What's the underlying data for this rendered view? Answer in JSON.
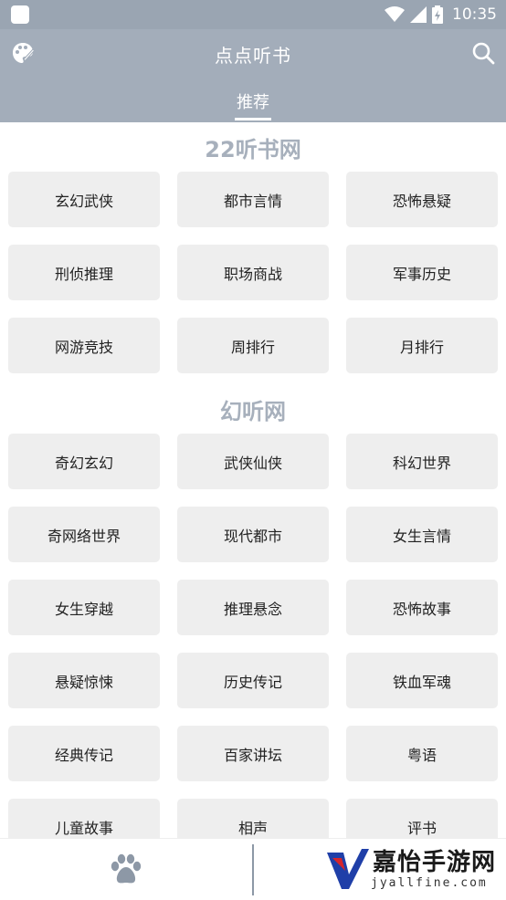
{
  "status_bar": {
    "time": "10:35"
  },
  "app_bar": {
    "title": "点点听书",
    "tabs": [
      {
        "label": "推荐",
        "active": true
      }
    ]
  },
  "sections": [
    {
      "title": "22听书网",
      "items": [
        "玄幻武侠",
        "都市言情",
        "恐怖悬疑",
        "刑侦推理",
        "职场商战",
        "军事历史",
        "网游竞技",
        "周排行",
        "月排行"
      ]
    },
    {
      "title": "幻听网",
      "items": [
        "奇幻玄幻",
        "武侠仙侠",
        "科幻世界",
        "奇网络世界",
        "现代都市",
        "女生言情",
        "女生穿越",
        "推理悬念",
        "恐怖故事",
        "悬疑惊悚",
        "历史传记",
        "铁血军魂",
        "经典传记",
        "百家讲坛",
        "粤语",
        "儿童故事",
        "相声",
        "评书"
      ]
    }
  ],
  "watermark": {
    "text": "嘉怡手游网",
    "sub": "jyallfine.com"
  },
  "colors": {
    "app_bar": "#a3adba",
    "status_bar": "#9aa5b2",
    "section_title": "#a7b0bc",
    "button_bg": "#eeeeee"
  },
  "icons": {
    "palette": "palette-icon",
    "search": "search-icon",
    "paw": "paw-icon"
  }
}
